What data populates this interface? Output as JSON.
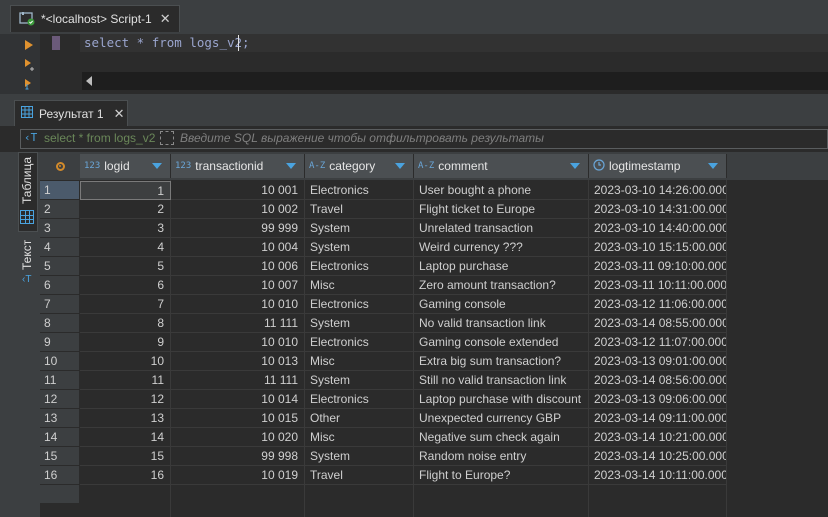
{
  "editor": {
    "tab_title": "*<localhost> Script-1",
    "tab_close": "✕",
    "sql": "select * from logs_v2;"
  },
  "results": {
    "tab_title": "Результат 1",
    "tab_close": "✕",
    "filter_query": "select * from logs_v2",
    "filter_placeholder": "Введите SQL выражение чтобы отфильтровать результаты",
    "side_tabs": {
      "table": "Таблица",
      "text": "Текст"
    },
    "columns": [
      {
        "name": "logid",
        "type_badge": "123"
      },
      {
        "name": "transactionid",
        "type_badge": "123"
      },
      {
        "name": "category",
        "type_badge": "A-Z"
      },
      {
        "name": "comment",
        "type_badge": "A-Z"
      },
      {
        "name": "logtimestamp",
        "type_badge": "clock-icon"
      }
    ],
    "selected_row": 1,
    "rows": [
      [
        "1",
        "1",
        "10 001",
        "Electronics",
        "User bought a phone",
        "2023-03-10 14:26:00.000"
      ],
      [
        "2",
        "2",
        "10 002",
        "Travel",
        "Flight ticket to Europe",
        "2023-03-10 14:31:00.000"
      ],
      [
        "3",
        "3",
        "99 999",
        "System",
        "Unrelated transaction",
        "2023-03-10 14:40:00.000"
      ],
      [
        "4",
        "4",
        "10 004",
        "System",
        "Weird currency ???",
        "2023-03-10 15:15:00.000"
      ],
      [
        "5",
        "5",
        "10 006",
        "Electronics",
        "Laptop purchase",
        "2023-03-11 09:10:00.000"
      ],
      [
        "6",
        "6",
        "10 007",
        "Misc",
        "Zero amount transaction?",
        "2023-03-11 10:11:00.000"
      ],
      [
        "7",
        "7",
        "10 010",
        "Electronics",
        "Gaming console",
        "2023-03-12 11:06:00.000"
      ],
      [
        "8",
        "8",
        "11 111",
        "System",
        "No valid transaction link",
        "2023-03-14 08:55:00.000"
      ],
      [
        "9",
        "9",
        "10 010",
        "Electronics",
        "Gaming console extended",
        "2023-03-12 11:07:00.000"
      ],
      [
        "10",
        "10",
        "10 013",
        "Misc",
        "Extra big sum transaction?",
        "2023-03-13 09:01:00.000"
      ],
      [
        "11",
        "11",
        "11 111",
        "System",
        "Still no valid transaction link",
        "2023-03-14 08:56:00.000"
      ],
      [
        "12",
        "12",
        "10 014",
        "Electronics",
        "Laptop purchase with discount",
        "2023-03-13 09:06:00.000"
      ],
      [
        "13",
        "13",
        "10 015",
        "Other",
        "Unexpected currency GBP",
        "2023-03-14 09:11:00.000"
      ],
      [
        "14",
        "14",
        "10 020",
        "Misc",
        "Negative sum check again",
        "2023-03-14 10:21:00.000"
      ],
      [
        "15",
        "15",
        "99 998",
        "System",
        "Random noise entry",
        "2023-03-14 10:25:00.000"
      ],
      [
        "16",
        "16",
        "10 019",
        "Travel",
        "Flight to Europe?",
        "2023-03-14 10:11:00.000"
      ]
    ]
  },
  "colors": {
    "accent": "#4aa3df",
    "header_bg": "#4b4f52",
    "background": "#2b2b2b"
  }
}
